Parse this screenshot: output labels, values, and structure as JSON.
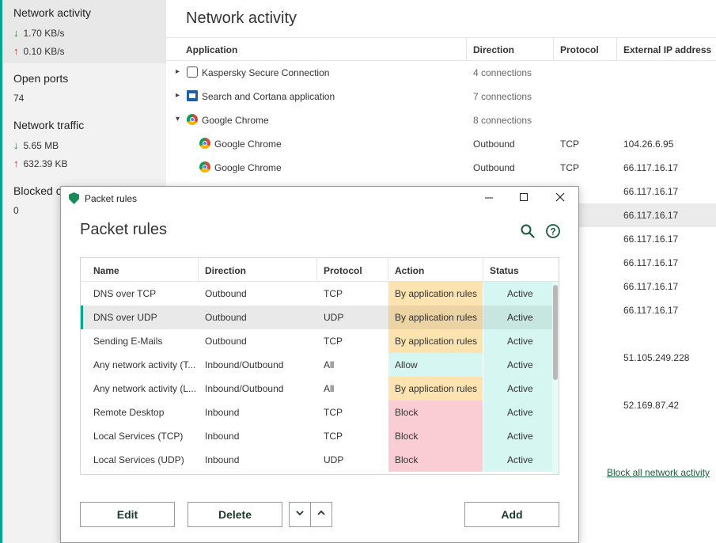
{
  "colors": {
    "accent": "#00a88e",
    "action_by_app": "#fde3b0",
    "action_allow": "#d6f7f1",
    "action_block": "#f9cdd3",
    "status_active": "#d6f7f1"
  },
  "sidebar": {
    "network_activity": {
      "title": "Network activity",
      "down": "1.70 KB/s",
      "up": "0.10 KB/s"
    },
    "open_ports": {
      "title": "Open ports",
      "value": "74"
    },
    "network_traffic": {
      "title": "Network traffic",
      "down": "5.65 MB",
      "up": "632.39 KB"
    },
    "blocked": {
      "title": "Blocked c",
      "value": "0"
    }
  },
  "main": {
    "title": "Network activity",
    "columns": {
      "application": "Application",
      "direction": "Direction",
      "protocol": "Protocol",
      "ip": "External IP address"
    },
    "rows": [
      {
        "name": "Kaspersky Secure Connection",
        "direction": "4 connections",
        "protocol": "",
        "ip": "",
        "icon": "kaspersky-secure-connection-icon",
        "expander": "▸"
      },
      {
        "name": "Search and Cortana application",
        "direction": "7 connections",
        "protocol": "",
        "ip": "",
        "icon": "cortana-icon",
        "expander": "▸"
      },
      {
        "name": "Google Chrome",
        "direction": "8 connections",
        "protocol": "",
        "ip": "",
        "icon": "chrome-icon",
        "expander": "▾"
      },
      {
        "name": "Google Chrome",
        "direction": "Outbound",
        "protocol": "TCP",
        "ip": "104.26.6.95",
        "icon": "chrome-icon"
      },
      {
        "name": "Google Chrome",
        "direction": "Outbound",
        "protocol": "TCP",
        "ip": "66.117.16.17",
        "icon": "chrome-icon"
      }
    ],
    "hidden_ips": [
      "66.117.16.17",
      "66.117.16.17",
      "66.117.16.17",
      "66.117.16.17",
      "66.117.16.17",
      "66.117.16.17",
      "51.105.249.228",
      "52.169.87.42"
    ],
    "block_all_link": "Block all network activity"
  },
  "dialog": {
    "window_title": "Packet rules",
    "heading": "Packet rules",
    "columns": {
      "name": "Name",
      "direction": "Direction",
      "protocol": "Protocol",
      "action": "Action",
      "status": "Status"
    },
    "rules": [
      {
        "name": "DNS over TCP",
        "direction": "Outbound",
        "protocol": "TCP",
        "action": "By application rules",
        "status": "Active"
      },
      {
        "name": "DNS over UDP",
        "direction": "Outbound",
        "protocol": "UDP",
        "action": "By application rules",
        "status": "Active"
      },
      {
        "name": "Sending E-Mails",
        "direction": "Outbound",
        "protocol": "TCP",
        "action": "By application rules",
        "status": "Active"
      },
      {
        "name": "Any network activity (T...",
        "direction": "Inbound/Outbound",
        "protocol": "All",
        "action": "Allow",
        "status": "Active"
      },
      {
        "name": "Any network activity (L...",
        "direction": "Inbound/Outbound",
        "protocol": "All",
        "action": "By application rules",
        "status": "Active"
      },
      {
        "name": "Remote Desktop",
        "direction": "Inbound",
        "protocol": "TCP",
        "action": "Block",
        "status": "Active"
      },
      {
        "name": "Local Services (TCP)",
        "direction": "Inbound",
        "protocol": "TCP",
        "action": "Block",
        "status": "Active"
      },
      {
        "name": "Local Services (UDP)",
        "direction": "Inbound",
        "protocol": "UDP",
        "action": "Block",
        "status": "Active"
      }
    ],
    "buttons": {
      "edit": "Edit",
      "delete": "Delete",
      "move_down": "∨",
      "move_up": "∧",
      "add": "Add"
    }
  }
}
